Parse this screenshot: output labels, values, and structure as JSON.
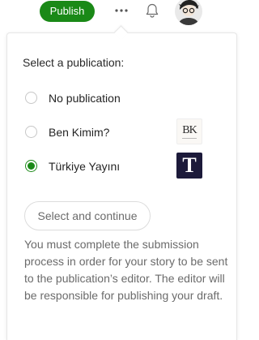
{
  "topbar": {
    "publish_label": "Publish",
    "more_icon": "more-horizontal-icon",
    "notifications_icon": "bell-icon"
  },
  "popover": {
    "heading": "Select a publication:",
    "options": [
      {
        "label": "No publication",
        "checked": false
      },
      {
        "label": "Ben Kimim?",
        "checked": false,
        "logo": "BK"
      },
      {
        "label": "Türkiye Yayını",
        "checked": true,
        "logo": "T"
      }
    ],
    "continue_label": "Select and continue",
    "info": "You must complete the submission process in order for your story to be sent to the publication’s editor. The editor will be responsible for publishing your draft."
  },
  "colors": {
    "accent": "#1a8917",
    "muted_text": "#6b6b6b",
    "logo_dark": "#1c1a3a"
  }
}
